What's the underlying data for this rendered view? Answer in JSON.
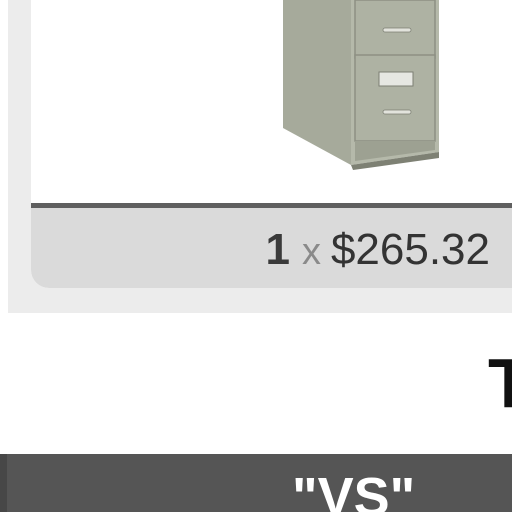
{
  "product_card": {
    "image_icon": "filing-cabinet-icon",
    "quantity": "1",
    "multiply_symbol": "x",
    "price": "$265.32"
  },
  "heading": {
    "partial_text": "T"
  },
  "comparison_bar": {
    "label": "\"VS\""
  },
  "colors": {
    "divider": "#5f5f5f",
    "price_bar": "#dadada",
    "vs_bar": "#555555"
  }
}
